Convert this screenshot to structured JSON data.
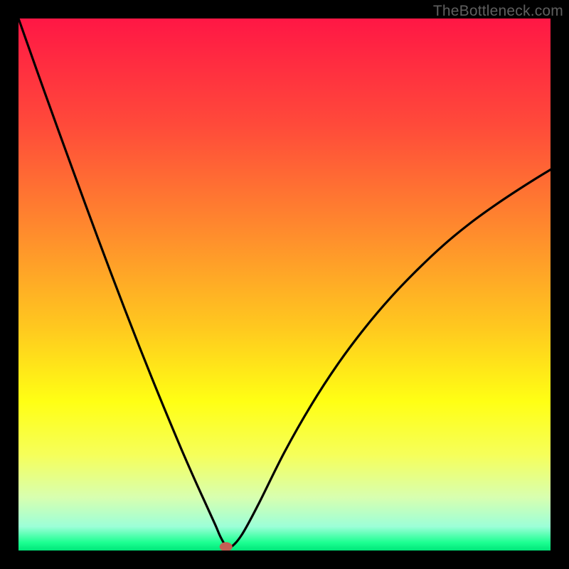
{
  "watermark": "TheBottleneck.com",
  "chart_data": {
    "type": "line",
    "title": "",
    "xlabel": "",
    "ylabel": "",
    "xlim": [
      0,
      100
    ],
    "ylim": [
      0,
      100
    ],
    "grid": false,
    "series": [
      {
        "name": "curve",
        "x": [
          0,
          5,
          10,
          15,
          20,
          25,
          30,
          33,
          35,
          37,
          38,
          39,
          40,
          42,
          45,
          50,
          55,
          60,
          65,
          70,
          75,
          80,
          85,
          90,
          95,
          100
        ],
        "y": [
          100,
          85.9,
          72.1,
          58.5,
          45.3,
          32.6,
          20.5,
          13.6,
          9.2,
          4.8,
          2.5,
          0.9,
          0.7,
          3.0,
          8.5,
          18.5,
          27.3,
          35.0,
          41.7,
          47.6,
          52.8,
          57.5,
          61.6,
          65.2,
          68.5,
          71.6
        ]
      }
    ],
    "gradient_stops": [
      {
        "pos": 0.0,
        "color": "#ff1745"
      },
      {
        "pos": 0.2,
        "color": "#ff4a3a"
      },
      {
        "pos": 0.4,
        "color": "#ff8b2d"
      },
      {
        "pos": 0.58,
        "color": "#ffc81f"
      },
      {
        "pos": 0.72,
        "color": "#ffff14"
      },
      {
        "pos": 0.82,
        "color": "#f6ff5a"
      },
      {
        "pos": 0.9,
        "color": "#d8ffb0"
      },
      {
        "pos": 0.955,
        "color": "#9cffd8"
      },
      {
        "pos": 0.985,
        "color": "#1cff91"
      },
      {
        "pos": 1.0,
        "color": "#00e67a"
      }
    ],
    "marker": {
      "x": 39,
      "y": 0.7,
      "color": "#c46054"
    }
  }
}
